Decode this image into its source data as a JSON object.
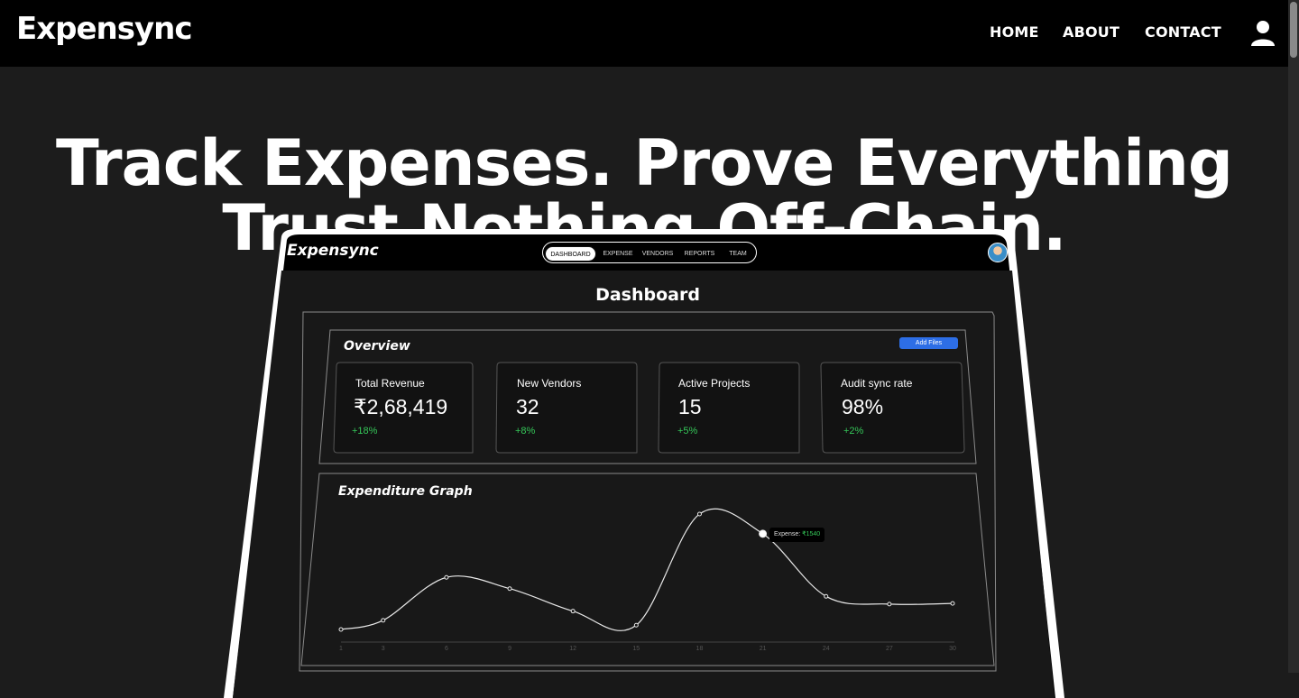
{
  "site": {
    "brand": "Expensync",
    "nav": [
      "HOME",
      "ABOUT",
      "CONTACT"
    ],
    "icons": [
      "user-icon"
    ]
  },
  "hero": {
    "line1": "Track Expenses. Prove Everything",
    "line2": "Trust Nothing Off-Chain."
  },
  "app": {
    "brand": "Expensync",
    "tabs": [
      "DASHBOARD",
      "EXPENSE",
      "VENDORS",
      "REPORTS",
      "TEAM"
    ],
    "active_tab": "DASHBOARD",
    "page_title": "Dashboard",
    "overview": {
      "title": "Overview",
      "add_files": "Add Files",
      "stats": [
        {
          "label": "Total Revenue",
          "value": "₹2,68,419",
          "change": "+18%"
        },
        {
          "label": "New Vendors",
          "value": "32",
          "change": "+8%"
        },
        {
          "label": "Active Projects",
          "value": "15",
          "change": "+5%"
        },
        {
          "label": "Audit sync rate",
          "value": "98%",
          "change": "+2%"
        }
      ]
    },
    "graph": {
      "title": "Expenditure Graph",
      "tooltip_label": "Expense:",
      "tooltip_value": "₹1540"
    }
  },
  "colors": {
    "background": "#1c1c1c",
    "topbar": "#000000",
    "accent_blue": "#2d6ee6",
    "positive_green": "#35c759"
  },
  "chart_data": {
    "type": "line",
    "x": [
      1,
      3,
      6,
      9,
      12,
      15,
      18,
      21,
      24,
      27,
      30
    ],
    "series": [
      {
        "values": [
          180,
          310,
          920,
          760,
          440,
          240,
          1820,
          1540,
          650,
          540,
          550
        ]
      }
    ],
    "xticks": [
      "1",
      "3",
      "6",
      "9",
      "12",
      "15",
      "18",
      "21",
      "24",
      "27",
      "30"
    ],
    "highlight": {
      "x": 21,
      "y": 1540
    }
  }
}
